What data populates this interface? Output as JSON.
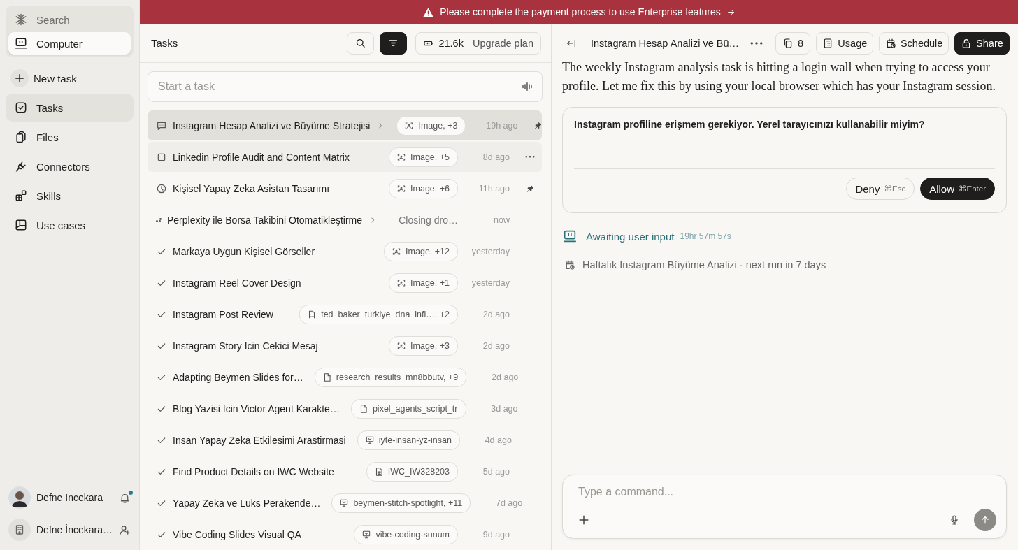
{
  "sidebar": {
    "modes": [
      {
        "label": "Search",
        "selected": false
      },
      {
        "label": "Computer",
        "selected": true
      }
    ],
    "items": [
      {
        "label": "New task",
        "selected": false
      },
      {
        "label": "Tasks",
        "selected": true
      },
      {
        "label": "Files",
        "selected": false
      },
      {
        "label": "Connectors",
        "selected": false
      },
      {
        "label": "Skills",
        "selected": false
      },
      {
        "label": "Use cases",
        "selected": false
      }
    ],
    "accounts": [
      {
        "name": "Defne Incekara",
        "kind": "user",
        "unread": true
      },
      {
        "name": "Defne İncekara…",
        "kind": "workspace",
        "unread": false
      }
    ]
  },
  "banner": {
    "text": "Please complete the payment process to use Enterprise features"
  },
  "tasks": {
    "title": "Tasks",
    "credits": "21.6k",
    "upgrade": "Upgrade plan",
    "search": {
      "placeholder": "Start a task"
    },
    "rows": [
      {
        "kind": "chat",
        "title": "Instagram Hesap Analizi ve Büyüme Stratejisi",
        "chevron": true,
        "chip": {
          "kind": "image",
          "text": "Image, +3"
        },
        "time": "19h ago",
        "pinned": true,
        "selected": true,
        "hovered": false
      },
      {
        "kind": "draft",
        "title": "Linkedin Profile Audit and Content Matrix",
        "chevron": false,
        "chip": {
          "kind": "image",
          "text": "Image, +5"
        },
        "time": "8d ago",
        "pinned": false,
        "selected": false,
        "hovered": true
      },
      {
        "kind": "scheduled",
        "title": "Kişisel Yapay Zeka Asistan Tasarımı",
        "chevron": false,
        "chip": {
          "kind": "image",
          "text": "Image, +6"
        },
        "time": "11h ago",
        "pinned": true,
        "selected": false,
        "hovered": false
      },
      {
        "kind": "running",
        "title": "Perplexity ile Borsa Takibini Otomatikleştirme",
        "chevron": true,
        "status": "Closing dro…",
        "time": "now",
        "pinned": false,
        "selected": false,
        "hovered": false
      },
      {
        "kind": "done",
        "title": "Markaya Uygun Kişisel Görseller",
        "chevron": false,
        "chip": {
          "kind": "image",
          "text": "Image, +12"
        },
        "time": "yesterday",
        "pinned": false,
        "selected": false,
        "hovered": false
      },
      {
        "kind": "done",
        "title": "Instagram Reel Cover Design",
        "chevron": false,
        "chip": {
          "kind": "image",
          "text": "Image, +1"
        },
        "time": "yesterday",
        "pinned": false,
        "selected": false,
        "hovered": false
      },
      {
        "kind": "done",
        "title": "Instagram Post Review",
        "chevron": false,
        "chip": {
          "kind": "document",
          "text": "ted_baker_turkiye_dna_infl…, +2"
        },
        "time": "2d ago",
        "pinned": false,
        "selected": false,
        "hovered": false
      },
      {
        "kind": "done",
        "title": "Instagram Story Icin Cekici Mesaj",
        "chevron": false,
        "chip": {
          "kind": "image",
          "text": "Image, +3"
        },
        "time": "2d ago",
        "pinned": false,
        "selected": false,
        "hovered": false
      },
      {
        "kind": "done",
        "title": "Adapting Beymen Slides for…",
        "chevron": false,
        "chip": {
          "kind": "file",
          "text": "research_results_mn8bbutv, +9"
        },
        "time": "2d ago",
        "pinned": false,
        "selected": false,
        "hovered": false
      },
      {
        "kind": "done",
        "title": "Blog Yazisi Icin Victor Agent Karakte…",
        "chevron": false,
        "chip": {
          "kind": "file",
          "text": "pixel_agents_script_tr"
        },
        "time": "3d ago",
        "pinned": false,
        "selected": false,
        "hovered": false
      },
      {
        "kind": "done",
        "title": "Insan Yapay Zeka Etkilesimi Arastirmasi",
        "chevron": false,
        "chip": {
          "kind": "slides",
          "text": "iyte-insan-yz-insan"
        },
        "time": "4d ago",
        "pinned": false,
        "selected": false,
        "hovered": false
      },
      {
        "kind": "done",
        "title": "Find Product Details on IWC Website",
        "chevron": false,
        "chip": {
          "kind": "sheet",
          "text": "IWC_IW328203"
        },
        "time": "5d ago",
        "pinned": false,
        "selected": false,
        "hovered": false
      },
      {
        "kind": "done",
        "title": "Yapay Zeka ve Luks Perakende…",
        "chevron": false,
        "chip": {
          "kind": "slides",
          "text": "beymen-stitch-spotlight, +11"
        },
        "time": "7d ago",
        "pinned": false,
        "selected": false,
        "hovered": false
      },
      {
        "kind": "done",
        "title": "Vibe Coding Slides Visual QA",
        "chevron": false,
        "chip": {
          "kind": "slides",
          "text": "vibe-coding-sunum"
        },
        "time": "9d ago",
        "pinned": false,
        "selected": false,
        "hovered": false
      }
    ]
  },
  "detail": {
    "title": "Instagram Hesap Analizi ve Bü…",
    "copies": "8",
    "buttons": [
      {
        "label": "Usage",
        "kind": "outline"
      },
      {
        "label": "Schedule",
        "kind": "outline"
      },
      {
        "label": "Share",
        "kind": "primary"
      }
    ],
    "message": "The weekly Instagram analysis task is hitting a login wall when trying to access your profile. Let me fix this by using your local browser which has your Instagram session.",
    "prompt": {
      "question": "Instagram profiline erişmem gerekiyor. Yerel tarayıcınızı kullanabilir miyim?",
      "deny": {
        "label": "Deny",
        "shortcut": "⌘Esc"
      },
      "allow": {
        "label": "Allow",
        "shortcut": "⌘Enter"
      }
    },
    "status": {
      "text": "Awaiting user input",
      "elapsed": "19hr 57m 57s"
    },
    "schedule": "Haftalık Instagram Büyüme Analizi · next run in 7 days",
    "composer": {
      "placeholder": "Type a command..."
    }
  }
}
